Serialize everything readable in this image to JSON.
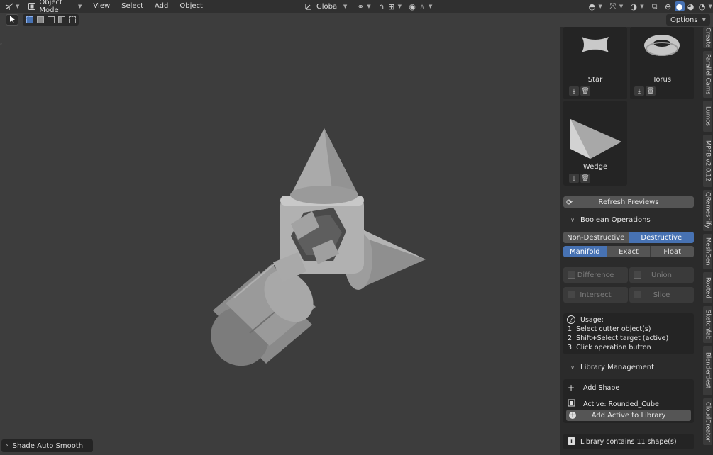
{
  "header": {
    "mode": "Object Mode",
    "menus": [
      "View",
      "Select",
      "Add",
      "Object"
    ],
    "orientation": "Global",
    "options": "Options"
  },
  "viewport": {
    "last_operator": "Shade Auto Smooth"
  },
  "library": {
    "shapes": [
      {
        "name": "Star",
        "icon": "star-shape-icon"
      },
      {
        "name": "Torus",
        "icon": "torus-shape-icon"
      },
      {
        "name": "Wedge",
        "icon": "wedge-shape-icon"
      }
    ],
    "refresh_label": "Refresh Previews"
  },
  "boolean": {
    "title": "Boolean Operations",
    "modes": [
      "Non-Destructive",
      "Destructive"
    ],
    "active_mode": "Destructive",
    "solvers": [
      "Manifold",
      "Exact",
      "Float"
    ],
    "active_solver": "Manifold",
    "ops": [
      "Difference",
      "Union",
      "Intersect",
      "Slice"
    ],
    "usage_title": "Usage:",
    "usage_lines": [
      "1. Select cutter object(s)",
      "2. Shift+Select target (active)",
      "3. Click operation button"
    ]
  },
  "library_management": {
    "title": "Library Management",
    "add_shape": "Add Shape",
    "active": "Active: Rounded_Cube",
    "add_active": "Add Active to Library",
    "count_text": "Library contains 11 shape(s)"
  },
  "tabs": [
    "Create",
    "Parallel Cams",
    "Lumos",
    "MPFB v2.0.12",
    "QRemeshify",
    "MeshGen",
    "Rooted",
    "Sketchfab",
    "Blenderdest",
    "CloudCreator"
  ],
  "colors": {
    "accent": "#4772b3",
    "background": "#3d3d3d",
    "panel": "#2b2b2b"
  }
}
